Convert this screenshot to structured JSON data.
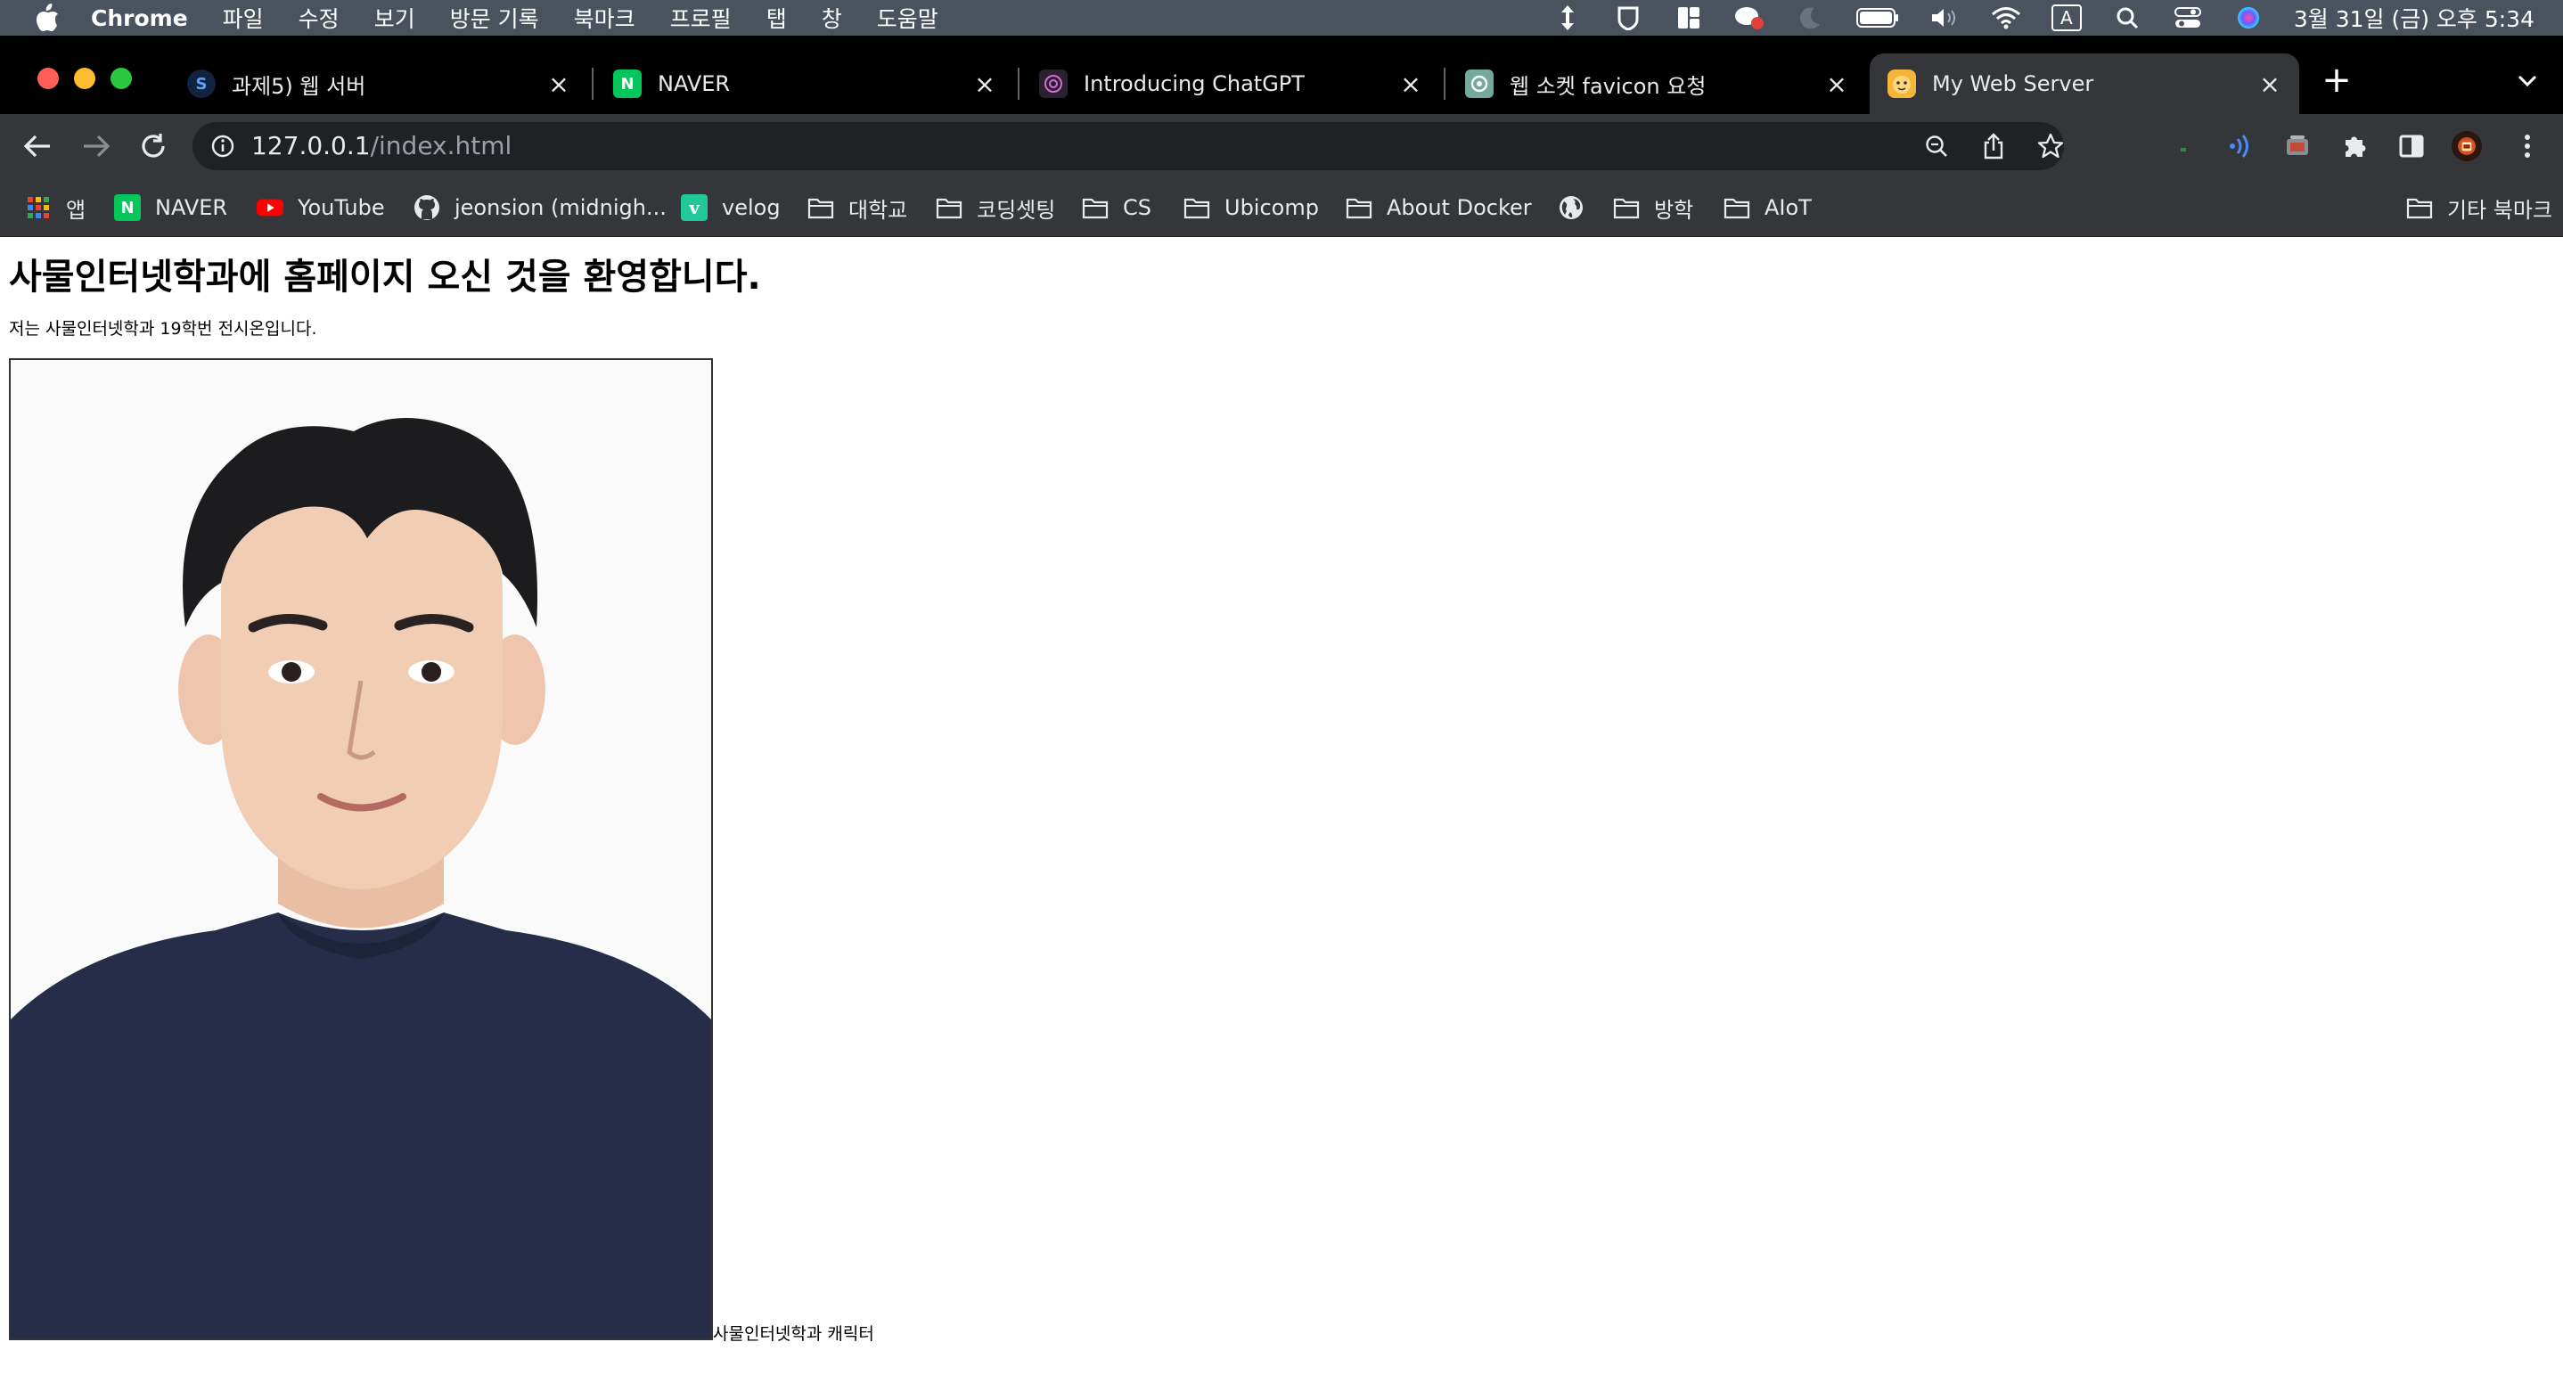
{
  "menubar": {
    "app_name": "Chrome",
    "menus": [
      "파일",
      "수정",
      "보기",
      "방문 기록",
      "북마크",
      "프로필",
      "탭",
      "창",
      "도움말"
    ],
    "clock": "3월 31일 (금) 오후 5:34",
    "input_source": "A"
  },
  "tabs": [
    {
      "title": "과제5) 웹 서버",
      "favicon": "S",
      "active": false
    },
    {
      "title": "NAVER",
      "favicon": "N",
      "active": false
    },
    {
      "title": "Introducing ChatGPT",
      "favicon": "openai-icon",
      "active": false
    },
    {
      "title": "웹 소켓 favicon 요청",
      "favicon": "chatgpt-icon",
      "active": false
    },
    {
      "title": "My Web Server",
      "favicon": "character-icon",
      "active": true
    }
  ],
  "address": {
    "host": "127.0.0.1",
    "path": "/index.html"
  },
  "bookmarks": [
    {
      "label": "앱",
      "icon": "apps-grid-icon"
    },
    {
      "label": "NAVER",
      "icon": "naver-icon"
    },
    {
      "label": "YouTube",
      "icon": "youtube-icon"
    },
    {
      "label": "jeonsion (midnigh...",
      "icon": "github-icon"
    },
    {
      "label": "velog",
      "icon": "velog-icon"
    },
    {
      "label": "대학교",
      "icon": "folder-icon"
    },
    {
      "label": "코딩셋팅",
      "icon": "folder-icon"
    },
    {
      "label": "CS",
      "icon": "folder-icon"
    },
    {
      "label": "Ubicomp",
      "icon": "folder-icon"
    },
    {
      "label": "About Docker",
      "icon": "folder-icon"
    },
    {
      "label": "",
      "icon": "globe-icon"
    },
    {
      "label": "방학",
      "icon": "folder-icon"
    },
    {
      "label": "AIoT",
      "icon": "folder-icon"
    },
    {
      "label": "기타 북마크",
      "icon": "folder-icon"
    }
  ],
  "page": {
    "heading": "사물인터넷학과에 홈페이지 오신 것을 환영합니다.",
    "intro": "저는 사물인터넷학과 19학번 전시온입니다.",
    "caption": "사물인터넷학과 캐릭터"
  },
  "colors": {
    "menubar": "#4a5260",
    "tabstrip": "#000000",
    "toolbar": "#35363a",
    "omnibox": "#202124",
    "shirt": "#262d48",
    "hair": "#1c1c1e",
    "skin": "#f0cdb4"
  }
}
